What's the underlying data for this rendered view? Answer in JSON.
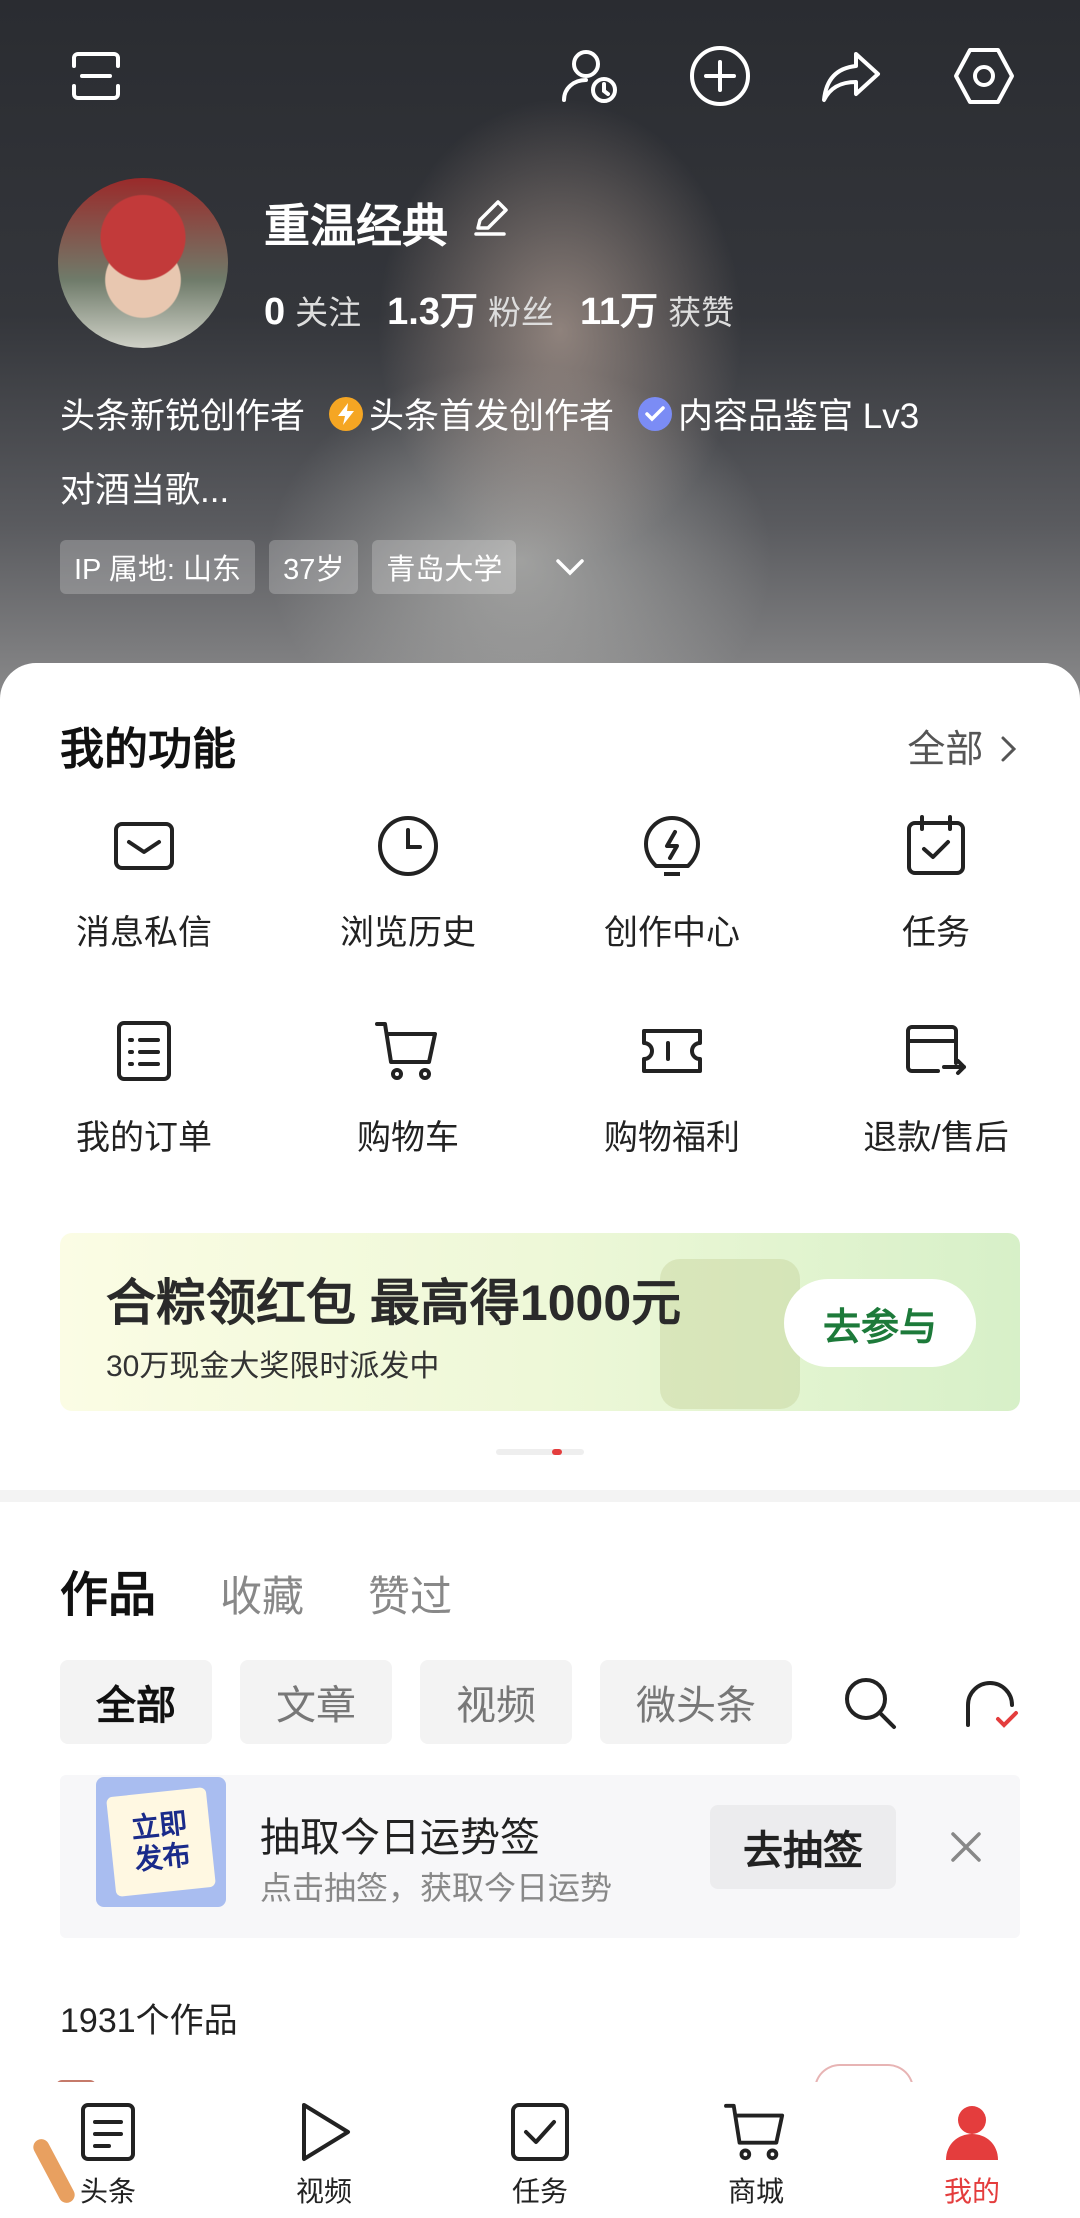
{
  "profile": {
    "name": "重温经典",
    "stats": [
      {
        "value": "0",
        "label": "关注"
      },
      {
        "value": "1.3万",
        "label": "粉丝"
      },
      {
        "value": "11万",
        "label": "获赞"
      }
    ],
    "badges": [
      "头条新锐创作者",
      "头条首发创作者",
      "内容品鉴官 Lv3"
    ],
    "bio": "对酒当歌...",
    "tags": [
      "IP 属地: 山东",
      "37岁",
      "青岛大学"
    ]
  },
  "functions": {
    "title": "我的功能",
    "all_label": "全部",
    "items": [
      {
        "label": "消息私信",
        "icon": "mail-icon"
      },
      {
        "label": "浏览历史",
        "icon": "clock-icon"
      },
      {
        "label": "创作中心",
        "icon": "lightbulb-icon"
      },
      {
        "label": "任务",
        "icon": "calendar-check-icon"
      },
      {
        "label": "我的订单",
        "icon": "order-list-icon"
      },
      {
        "label": "购物车",
        "icon": "cart-icon"
      },
      {
        "label": "购物福利",
        "icon": "coupon-icon"
      },
      {
        "label": "退款/售后",
        "icon": "refund-card-icon"
      }
    ]
  },
  "banner": {
    "title": "合粽领红包 最高得1000元",
    "subtitle": "30万现金大奖限时派发中",
    "button": "去参与"
  },
  "works": {
    "tabs": [
      "作品",
      "收藏",
      "赞过"
    ],
    "filters": [
      "全部",
      "文章",
      "视频",
      "微头条"
    ],
    "promo": {
      "image_text": [
        "立即",
        "发布"
      ],
      "title": "抽取今日运势签",
      "subtitle": "点击抽签，获取今日运势",
      "button": "去抽签"
    },
    "count_label": "1931个作品"
  },
  "bottom_nav": [
    {
      "label": "头条",
      "icon": "news-icon"
    },
    {
      "label": "视频",
      "icon": "play-icon"
    },
    {
      "label": "任务",
      "icon": "task-check-icon"
    },
    {
      "label": "商城",
      "icon": "cart-icon"
    },
    {
      "label": "我的",
      "icon": "person-icon"
    }
  ],
  "colors": {
    "accent": "#e43d3d",
    "banner_button": "#1d7a3a",
    "badge_orange": "#f5a623",
    "badge_blue": "#7b8cf5"
  }
}
